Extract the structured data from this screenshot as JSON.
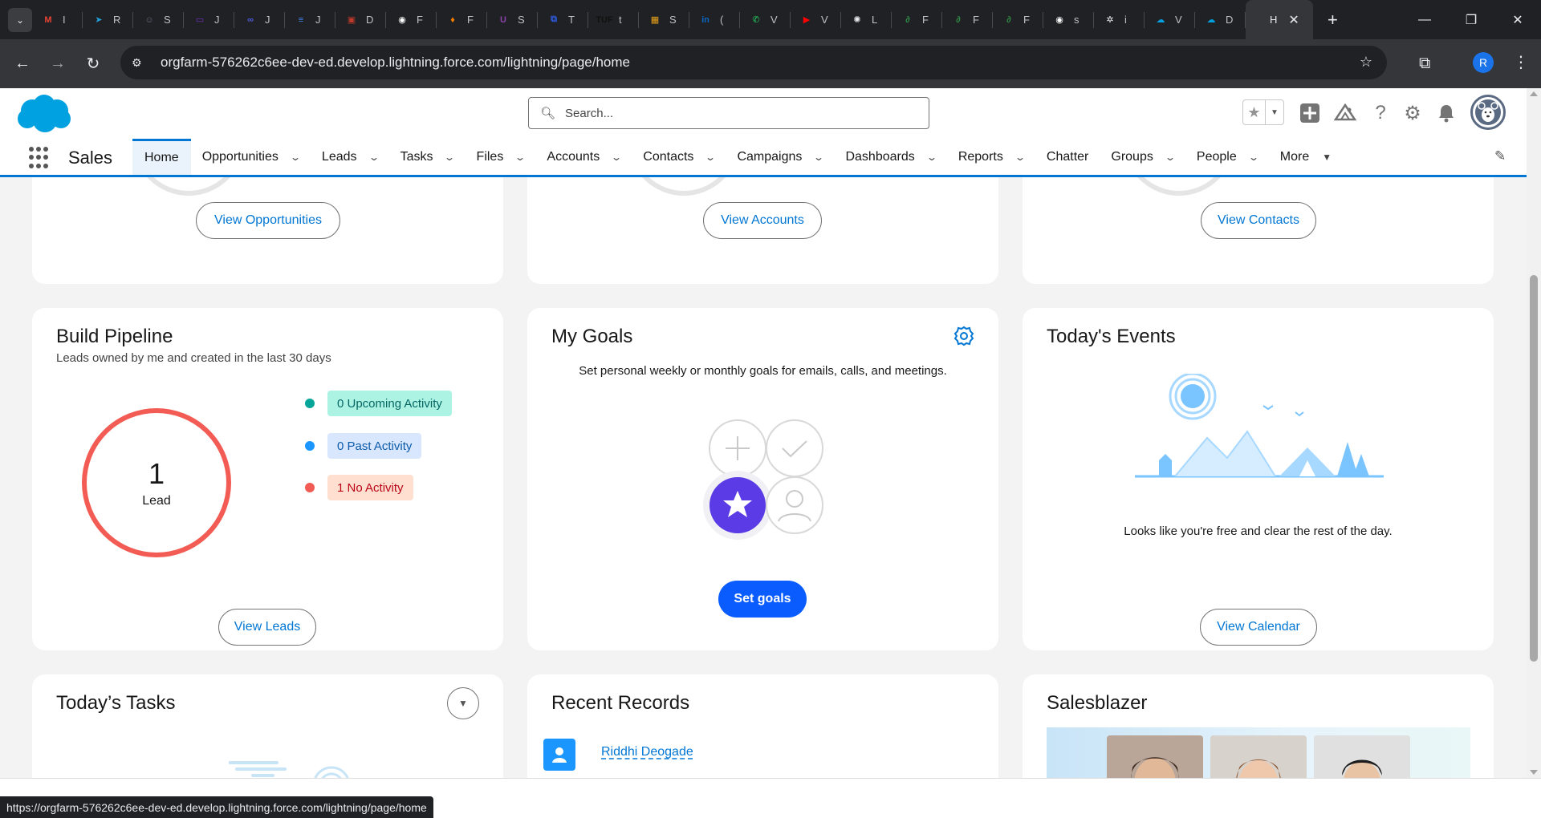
{
  "browser": {
    "tabs": [
      {
        "letter": "I",
        "color": "#ea4335",
        "glyph": "M",
        "name": "gmail-favicon"
      },
      {
        "letter": "R",
        "color": "#229ed9",
        "glyph": "➤",
        "name": "telegram-favicon"
      },
      {
        "letter": "S",
        "color": "#5f6a7a",
        "glyph": "☺",
        "name": "site-favicon"
      },
      {
        "letter": "J",
        "color": "#6f2dbd",
        "glyph": "▭",
        "name": "screen-favicon"
      },
      {
        "letter": "J",
        "color": "#4b5bdc",
        "glyph": "∞",
        "name": "link-favicon"
      },
      {
        "letter": "J",
        "color": "#4285f4",
        "glyph": "≡",
        "name": "docs-favicon"
      },
      {
        "letter": "D",
        "color": "#c0392b",
        "glyph": "▣",
        "name": "cat-favicon"
      },
      {
        "letter": "F",
        "color": "#ffffff",
        "glyph": "◉",
        "name": "github-favicon"
      },
      {
        "letter": "F",
        "color": "#f57c00",
        "glyph": "♦",
        "name": "fire-favicon"
      },
      {
        "letter": "S",
        "color": "#8e44ad",
        "glyph": "U",
        "name": "u-favicon"
      },
      {
        "letter": "T",
        "color": "#2d5be3",
        "glyph": "⧉",
        "name": "frame-favicon"
      },
      {
        "letter": "t",
        "color": "#111111",
        "glyph": "TUF",
        "name": "tuf-favicon"
      },
      {
        "letter": "S",
        "color": "#e7a21b",
        "glyph": "▦",
        "name": "box-favicon"
      },
      {
        "letter": "(",
        "color": "#0a66c2",
        "glyph": "in",
        "name": "linkedin-favicon"
      },
      {
        "letter": "V",
        "color": "#25d366",
        "glyph": "✆",
        "name": "whatsapp-favicon"
      },
      {
        "letter": "V",
        "color": "#ff0000",
        "glyph": "▶",
        "name": "youtube-favicon"
      },
      {
        "letter": "L",
        "color": "#e8eaed",
        "glyph": "✺",
        "name": "chatgpt-favicon"
      },
      {
        "letter": "F",
        "color": "#2f8d46",
        "glyph": "∂",
        "name": "gfg-favicon"
      },
      {
        "letter": "F",
        "color": "#2f8d46",
        "glyph": "∂",
        "name": "gfg-favicon"
      },
      {
        "letter": "F",
        "color": "#2f8d46",
        "glyph": "∂",
        "name": "gfg-favicon"
      },
      {
        "letter": "s",
        "color": "#ffffff",
        "glyph": "◉",
        "name": "github-favicon"
      },
      {
        "letter": "i",
        "color": "#e8eaed",
        "glyph": "✲",
        "name": "pattern-favicon"
      },
      {
        "letter": "V",
        "color": "#00a1e0",
        "glyph": "☁",
        "name": "salesforce-favicon"
      },
      {
        "letter": "D",
        "color": "#00a1e0",
        "glyph": "☁",
        "name": "salesforce-favicon"
      }
    ],
    "active_tab": {
      "letter": "H",
      "close": "✕"
    },
    "url": "orgfarm-576262c6ee-dev-ed.develop.lightning.force.com/lightning/page/home",
    "profile_initial": "R",
    "status_url": "https://orgfarm-576262c6ee-dev-ed.develop.lightning.force.com/lightning/page/home"
  },
  "salesforce": {
    "search_placeholder": "Search...",
    "app_name": "Sales",
    "nav": [
      {
        "label": "Home",
        "active": true,
        "chevron": false
      },
      {
        "label": "Opportunities",
        "chevron": true
      },
      {
        "label": "Leads",
        "chevron": true
      },
      {
        "label": "Tasks",
        "chevron": true
      },
      {
        "label": "Files",
        "chevron": true
      },
      {
        "label": "Accounts",
        "chevron": true
      },
      {
        "label": "Contacts",
        "chevron": true
      },
      {
        "label": "Campaigns",
        "chevron": true
      },
      {
        "label": "Dashboards",
        "chevron": true
      },
      {
        "label": "Reports",
        "chevron": true
      },
      {
        "label": "Chatter",
        "chevron": false
      },
      {
        "label": "Groups",
        "chevron": true
      },
      {
        "label": "People",
        "chevron": true
      }
    ],
    "more_label": "More"
  },
  "cards": {
    "top": {
      "opportunities_btn": "View Opportunities",
      "accounts_btn": "View Accounts",
      "contacts_btn": "View Contacts"
    },
    "build_pipeline": {
      "title": "Build Pipeline",
      "subtitle": "Leads owned by me and created in the last 30 days",
      "count": "1",
      "count_label": "Lead",
      "legend": [
        {
          "label": "0 Upcoming Activity",
          "dot": "#06a59a",
          "bg": "#acf3e4",
          "fg": "#056764"
        },
        {
          "label": "0 Past Activity",
          "dot": "#1b96ff",
          "bg": "#d8e6fe",
          "fg": "#0b5cab"
        },
        {
          "label": "1 No Activity",
          "dot": "#f25c54",
          "bg": "#fedfd0",
          "fg": "#ba0517"
        }
      ],
      "button": "View Leads"
    },
    "my_goals": {
      "title": "My Goals",
      "description": "Set personal weekly or monthly goals for emails, calls, and meetings.",
      "button": "Set goals"
    },
    "todays_events": {
      "title": "Today's Events",
      "text": "Looks like you're free and clear the rest of the day.",
      "button": "View Calendar"
    },
    "todays_tasks": {
      "title": "Today’s Tasks"
    },
    "recent_records": {
      "title": "Recent Records",
      "record": "Riddhi Deogade"
    },
    "salesblazer": {
      "title": "Salesblazer"
    }
  },
  "colors": {
    "brand": "#0176d3",
    "salesforce_cloud": "#00a1e0",
    "lead_ring": "#f25c54",
    "goal_button": "#0b5cff"
  }
}
